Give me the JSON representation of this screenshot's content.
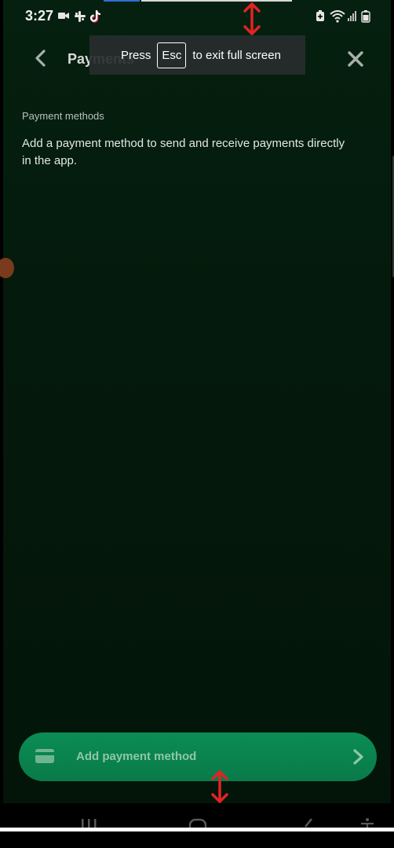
{
  "status_bar": {
    "time": "3:27",
    "left_icons": [
      "video-camera-icon",
      "slack-icon",
      "tiktok-icon"
    ],
    "right_icons": [
      "battery-saver-icon",
      "wifi-icon",
      "signal-icon",
      "battery-icon"
    ]
  },
  "fullscreen_toast": {
    "press": "Press",
    "key": "Esc",
    "message": "to exit full screen"
  },
  "header": {
    "title": "Payments",
    "back_icon": "chevron-left-icon",
    "close_icon": "close-icon"
  },
  "content": {
    "section_label": "Payment methods",
    "description": "Add a payment method to send and receive payments directly in the app."
  },
  "add_payment_button": {
    "label": "Add payment method",
    "icon": "credit-card-icon",
    "trailing_icon": "chevron-right-icon"
  },
  "colors": {
    "background": "#041a0c",
    "button_green": "#0b8d55",
    "arrow_red": "#e02424"
  }
}
